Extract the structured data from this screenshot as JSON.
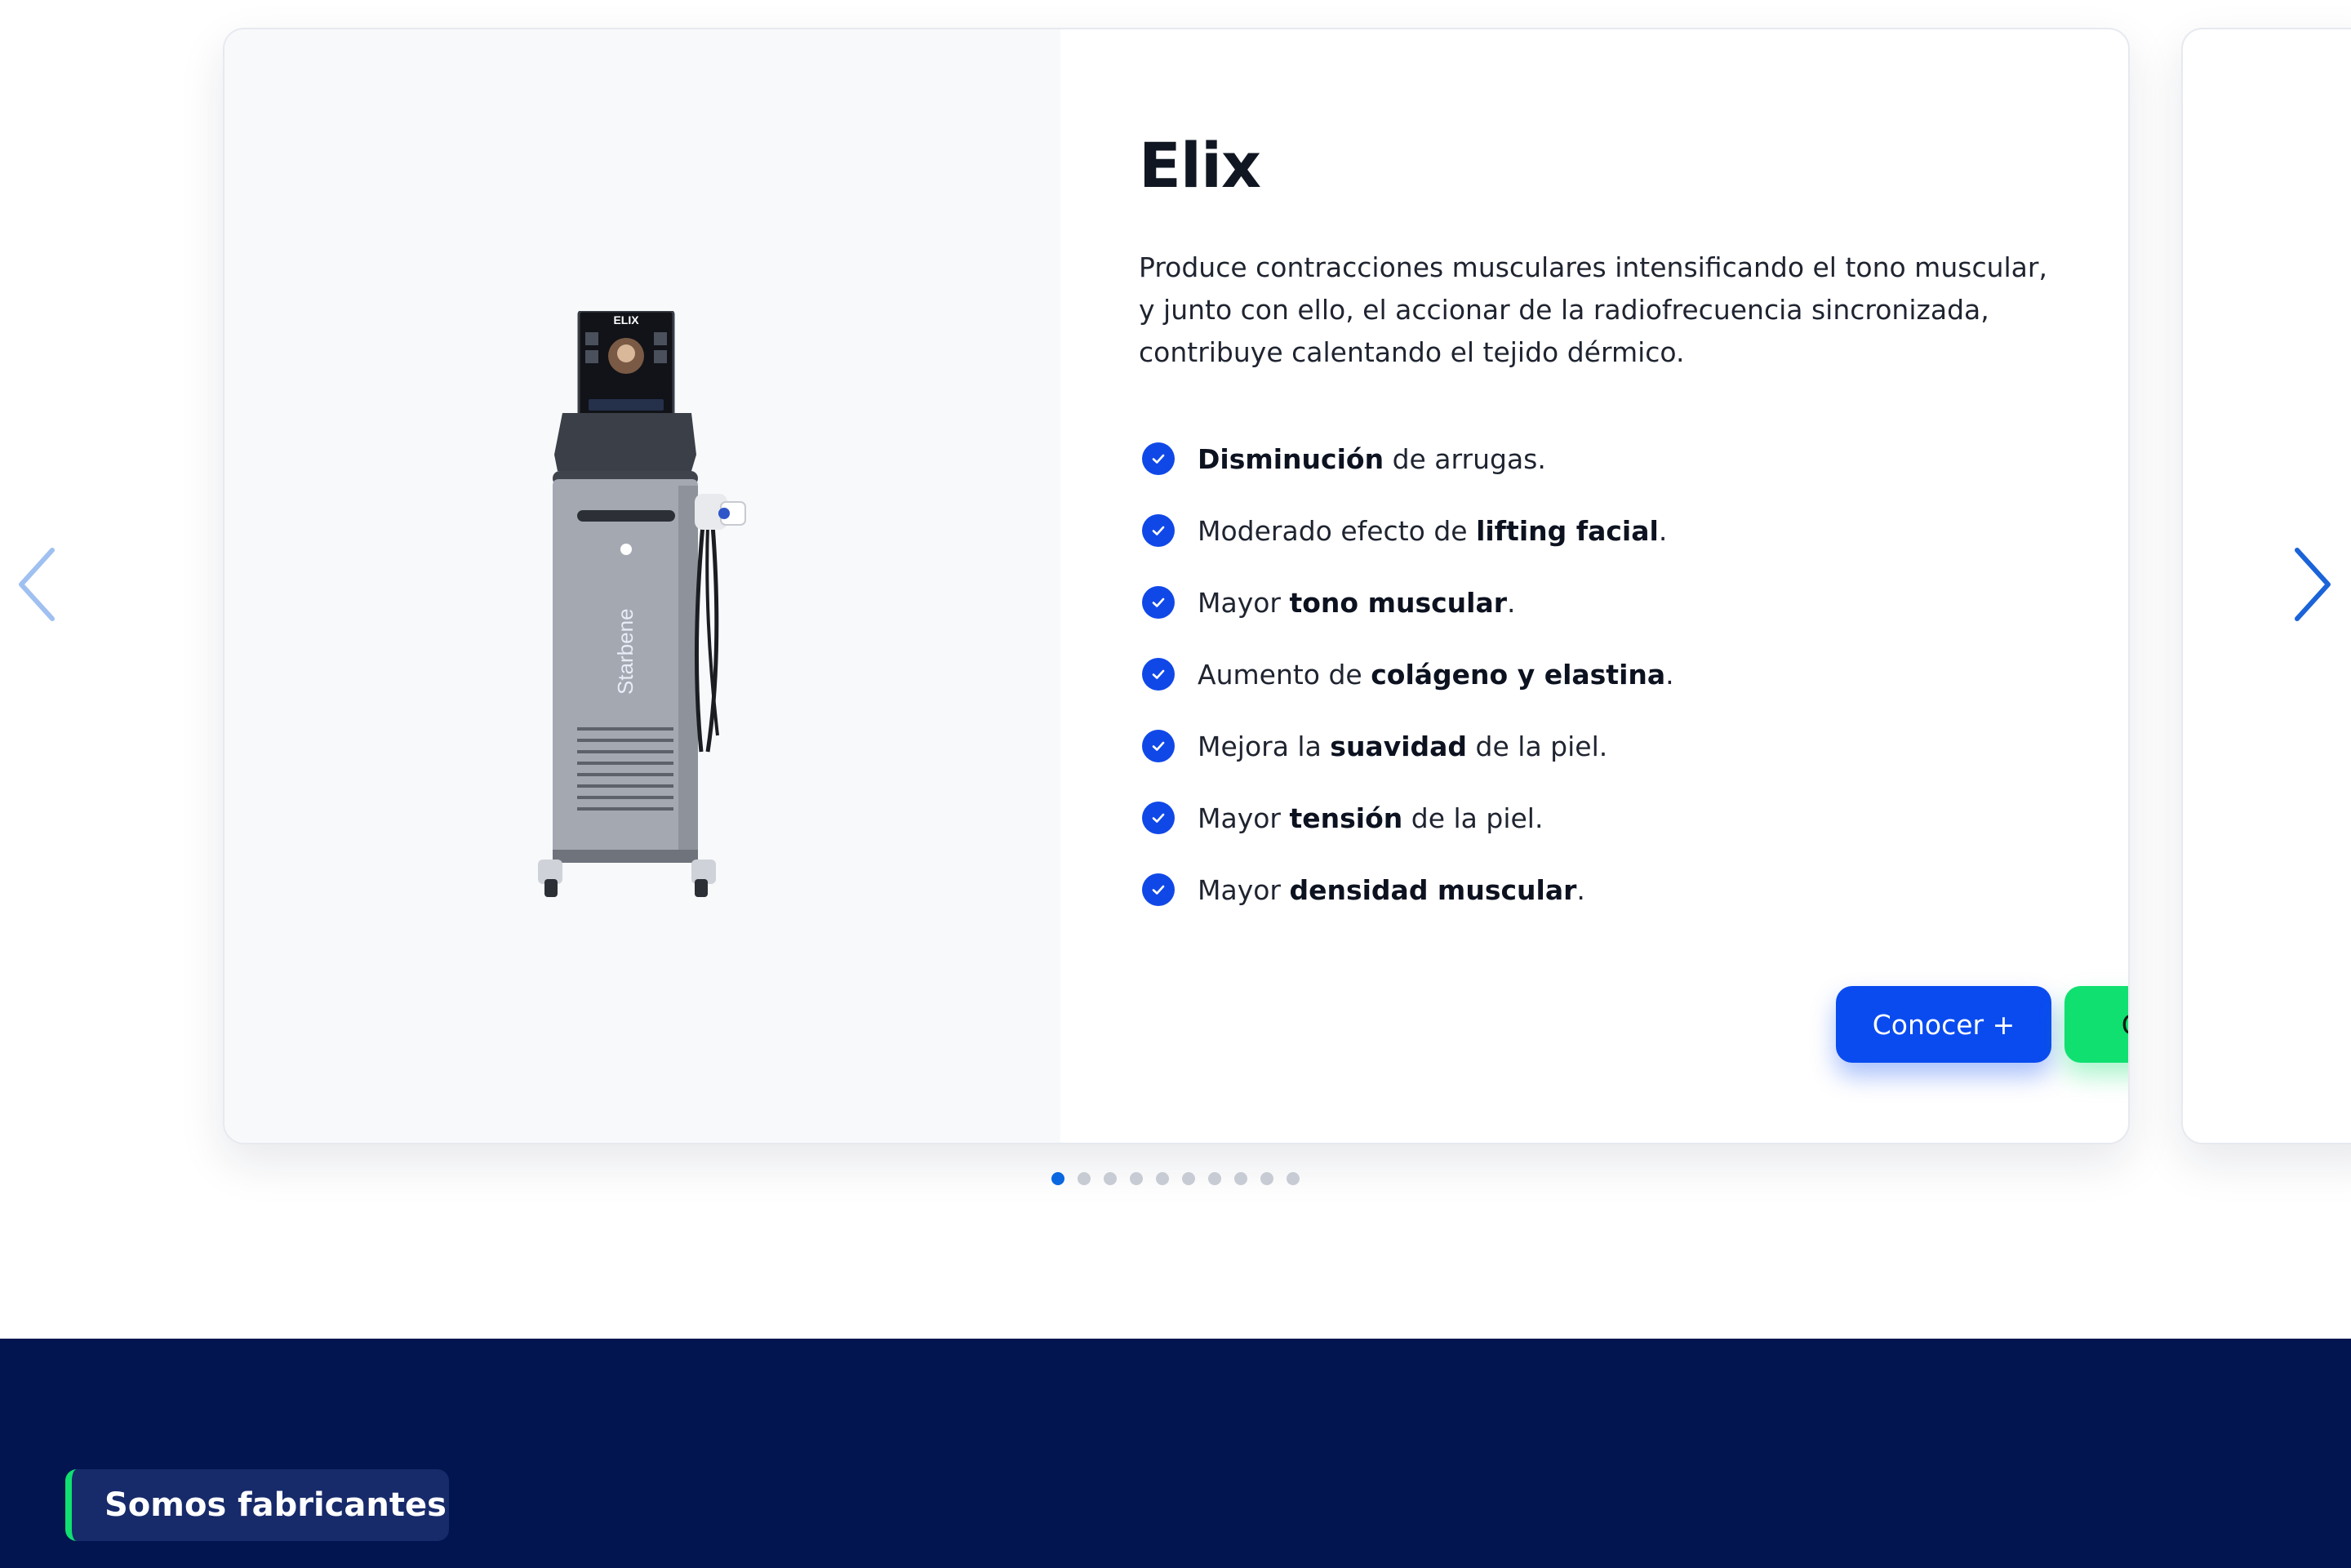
{
  "product": {
    "title": "Elix",
    "description": "Produce contracciones musculares intensificando el tono muscular, y junto con ello, el accionar de la radiofrecuencia sincronizada, contribuye calentando el tejido dérmico.",
    "image_brand_text": "Starbene",
    "screen_title": "ELIX",
    "benefits": [
      {
        "parts": [
          {
            "text": "Disminución",
            "bold": true
          },
          {
            "text": " de arrugas.",
            "bold": false
          }
        ]
      },
      {
        "parts": [
          {
            "text": "Moderado efecto de ",
            "bold": false
          },
          {
            "text": "lifting facial",
            "bold": true
          },
          {
            "text": ".",
            "bold": false
          }
        ]
      },
      {
        "parts": [
          {
            "text": "Mayor ",
            "bold": false
          },
          {
            "text": "tono muscular",
            "bold": true
          },
          {
            "text": ".",
            "bold": false
          }
        ]
      },
      {
        "parts": [
          {
            "text": "Aumento de ",
            "bold": false
          },
          {
            "text": "colágeno y elastina",
            "bold": true
          },
          {
            "text": ".",
            "bold": false
          }
        ]
      },
      {
        "parts": [
          {
            "text": "Mejora la ",
            "bold": false
          },
          {
            "text": "suavidad",
            "bold": true
          },
          {
            "text": " de la piel.",
            "bold": false
          }
        ]
      },
      {
        "parts": [
          {
            "text": "Mayor ",
            "bold": false
          },
          {
            "text": "tensión",
            "bold": true
          },
          {
            "text": " de la piel.",
            "bold": false
          }
        ]
      },
      {
        "parts": [
          {
            "text": "Mayor ",
            "bold": false
          },
          {
            "text": "densidad muscular",
            "bold": true
          },
          {
            "text": ".",
            "bold": false
          }
        ]
      }
    ],
    "buttons": {
      "know_more": "Conocer +",
      "quote": "Cotizar"
    }
  },
  "carousel": {
    "total_slides": 10,
    "active_index": 0,
    "prev_icon": "chevron-left-icon",
    "next_icon": "chevron-right-icon"
  },
  "section": {
    "badge_label": "Somos fabricantes"
  },
  "colors": {
    "primary": "#0a4bf0",
    "success": "#0fe070",
    "navy": "#021550",
    "check": "#1048e8"
  }
}
